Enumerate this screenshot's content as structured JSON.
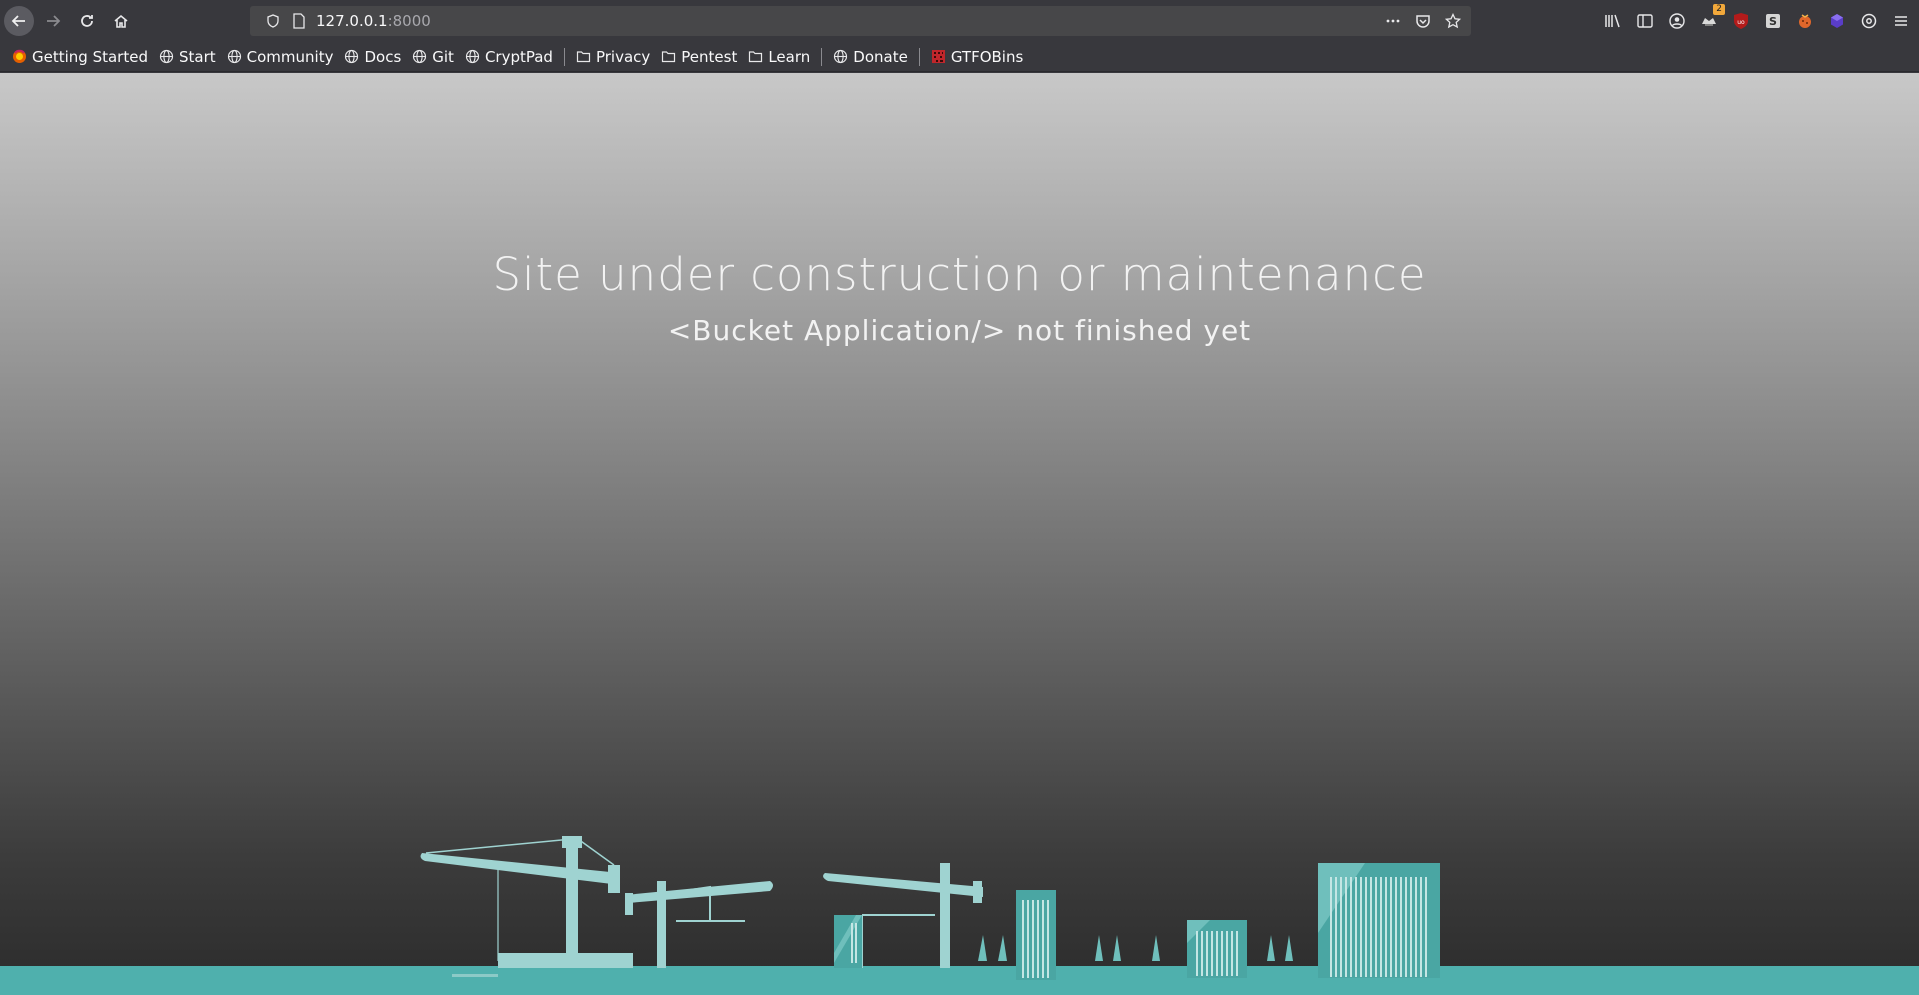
{
  "browser": {
    "url_host": "127.0.0.1",
    "url_port": ":8000",
    "extension_badge": "2",
    "bookmarks": [
      {
        "label": "Getting Started",
        "icon": "firefox-icon"
      },
      {
        "label": "Start",
        "icon": "globe-icon"
      },
      {
        "label": "Community",
        "icon": "globe-icon"
      },
      {
        "label": "Docs",
        "icon": "globe-icon"
      },
      {
        "label": "Git",
        "icon": "globe-icon"
      },
      {
        "label": "CryptPad",
        "icon": "globe-icon"
      },
      {
        "label": "Privacy",
        "icon": "folder-icon"
      },
      {
        "label": "Pentest",
        "icon": "folder-icon"
      },
      {
        "label": "Learn",
        "icon": "folder-icon"
      },
      {
        "label": "Donate",
        "icon": "globe-icon"
      },
      {
        "label": "GTFOBins",
        "icon": "gtfobins-icon"
      }
    ]
  },
  "page": {
    "title": "Site under construction or maintenance",
    "subtitle": "<Bucket Application/> not finished yet"
  },
  "colors": {
    "accent": "#4fb0ad",
    "crane": "#9fd3d1",
    "building": "#4aa6a3"
  }
}
